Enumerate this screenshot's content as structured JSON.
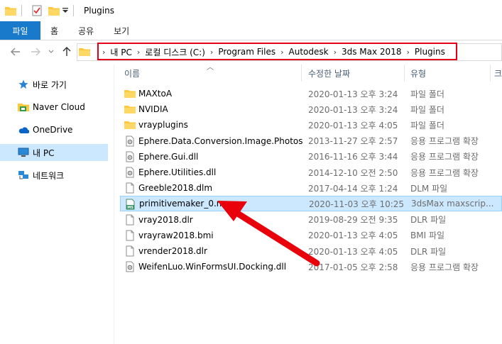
{
  "window": {
    "title": "Plugins"
  },
  "ribbon": {
    "tabs": [
      "파일",
      "홈",
      "공유",
      "보기"
    ]
  },
  "address": {
    "crumbs": [
      "내 PC",
      "로컬 디스크 (C:)",
      "Program Files",
      "Autodesk",
      "3ds Max 2018",
      "Plugins"
    ],
    "highlight_color": "#e2001a"
  },
  "sidebar": {
    "items": [
      {
        "label": "바로 가기",
        "icon": "star-icon"
      },
      {
        "label": "Naver Cloud",
        "icon": "cloud-folder-icon"
      },
      {
        "label": "OneDrive",
        "icon": "onedrive-icon"
      },
      {
        "label": "내 PC",
        "icon": "computer-icon",
        "selected": true
      },
      {
        "label": "네트워크",
        "icon": "network-icon"
      }
    ]
  },
  "columns": {
    "name": "이름",
    "date": "수정한 날짜",
    "type": "유형",
    "size": "크"
  },
  "files": [
    {
      "name": "MAXtoA",
      "date": "2020-01-13 오후 3:24",
      "type": "파일 폴더",
      "kind": "folder"
    },
    {
      "name": "NVIDIA",
      "date": "2020-01-13 오후 3:24",
      "type": "파일 폴더",
      "kind": "folder"
    },
    {
      "name": "vrayplugins",
      "date": "2020-01-13 오후 4:05",
      "type": "파일 폴더",
      "kind": "folder"
    },
    {
      "name": "Ephere.Data.Conversion.Image.Photosho...",
      "date": "2013-11-27 오후 2:57",
      "type": "응용 프로그램 확장",
      "kind": "dll"
    },
    {
      "name": "Ephere.Gui.dll",
      "date": "2016-11-16 오후 3:44",
      "type": "응용 프로그램 확장",
      "kind": "dll"
    },
    {
      "name": "Ephere.Utilities.dll",
      "date": "2014-12-10 오전 2:50",
      "type": "응용 프로그램 확장",
      "kind": "dll"
    },
    {
      "name": "Greeble2018.dlm",
      "date": "2017-04-14 오후 1:24",
      "type": "DLM 파일",
      "kind": "file"
    },
    {
      "name": "primitivemaker_0.ms",
      "date": "2020-11-03 오후 10:25",
      "type": "3dsMax maxscrip...",
      "kind": "ms",
      "selected": true
    },
    {
      "name": "vray2018.dlr",
      "date": "2019-08-29 오전 9:35",
      "type": "DLR 파일",
      "kind": "file"
    },
    {
      "name": "vrayraw2018.bmi",
      "date": "2020-01-13 오후 4:05",
      "type": "BMI 파일",
      "kind": "file"
    },
    {
      "name": "vrender2018.dlr",
      "date": "2020-01-13 오후 4:05",
      "type": "DLR 파일",
      "kind": "file"
    },
    {
      "name": "WeifenLuo.WinFormsUI.Docking.dll",
      "date": "2017-01-05 오후 2:58",
      "type": "응용 프로그램 확장",
      "kind": "dll"
    }
  ],
  "colors": {
    "selection": "#cce8ff",
    "accent": "#1979ca",
    "folder": "#ffc83d",
    "annotation_arrow": "#e8000b"
  }
}
